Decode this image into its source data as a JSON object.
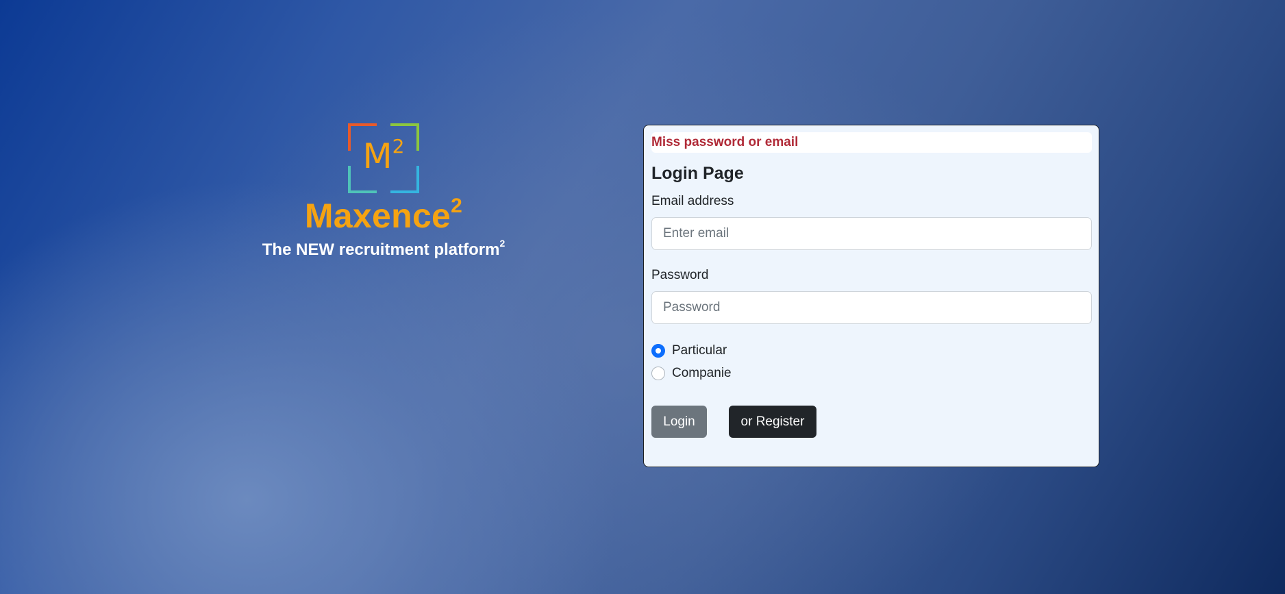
{
  "brand": {
    "logo_letter": "M",
    "logo_superscript": "2",
    "name": "Maxence",
    "name_superscript": "2",
    "tagline": "The NEW recruitment platform",
    "tagline_superscript": "2",
    "colors": {
      "accent": "#f5a312",
      "corner_top_left": "#e85a2a",
      "corner_top_right": "#8cc63f",
      "corner_bottom_left": "#4fc3b8",
      "corner_bottom_right": "#35b5e0"
    }
  },
  "login_form": {
    "error_message": "Miss password or email",
    "title": "Login Page",
    "email": {
      "label": "Email address",
      "value": "",
      "placeholder": "Enter email"
    },
    "password": {
      "label": "Password",
      "value": "",
      "placeholder": "Password"
    },
    "account_type": {
      "options": [
        {
          "label": "Particular",
          "checked": true
        },
        {
          "label": "Companie",
          "checked": false
        }
      ]
    },
    "login_button": "Login",
    "register_button": "or Register",
    "colors": {
      "error": "#b02a37",
      "radio_checked": "#0d6efd",
      "login_button_bg": "#6c757d",
      "register_button_bg": "#212529"
    }
  }
}
